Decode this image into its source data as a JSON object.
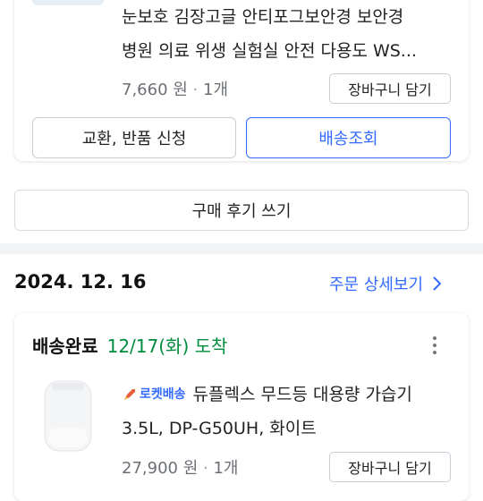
{
  "order1": {
    "product_title_line1": "눈보호 김장고글 안티포그보안경 보안경",
    "product_title_line2": "병원 의료 위생 실험실 안전 다용도 WS...",
    "price": "7,660 원",
    "quantity": "1개",
    "cart_button": "장바구니 담기",
    "exchange_button": "교환, 반품 신청",
    "tracking_button": "배송조회",
    "review_button": "구매 후기 쓰기"
  },
  "order2": {
    "date": "2024. 12. 16",
    "detail_link": "주문 상세보기",
    "status": "배송완료",
    "arrival": "12/17(화) 도착",
    "rocket_label": "로켓배송",
    "product_title_line1": "듀플렉스 무드등 대용량 가습기",
    "product_title_line2": "3.5L, DP-G50UH, 화이트",
    "price": "27,900 원",
    "quantity": "1개",
    "cart_button": "장바구니 담기"
  },
  "colors": {
    "accent_blue": "#346aff",
    "status_green": "#008c3c",
    "muted_text": "#6b6f75",
    "border": "#c9ced6",
    "separator": "#f2f3f5"
  },
  "icons": [
    "product-thumbnail",
    "rocket-icon",
    "more-vertical-icon",
    "chevron-right-icon",
    "humidifier-thumbnail"
  ]
}
